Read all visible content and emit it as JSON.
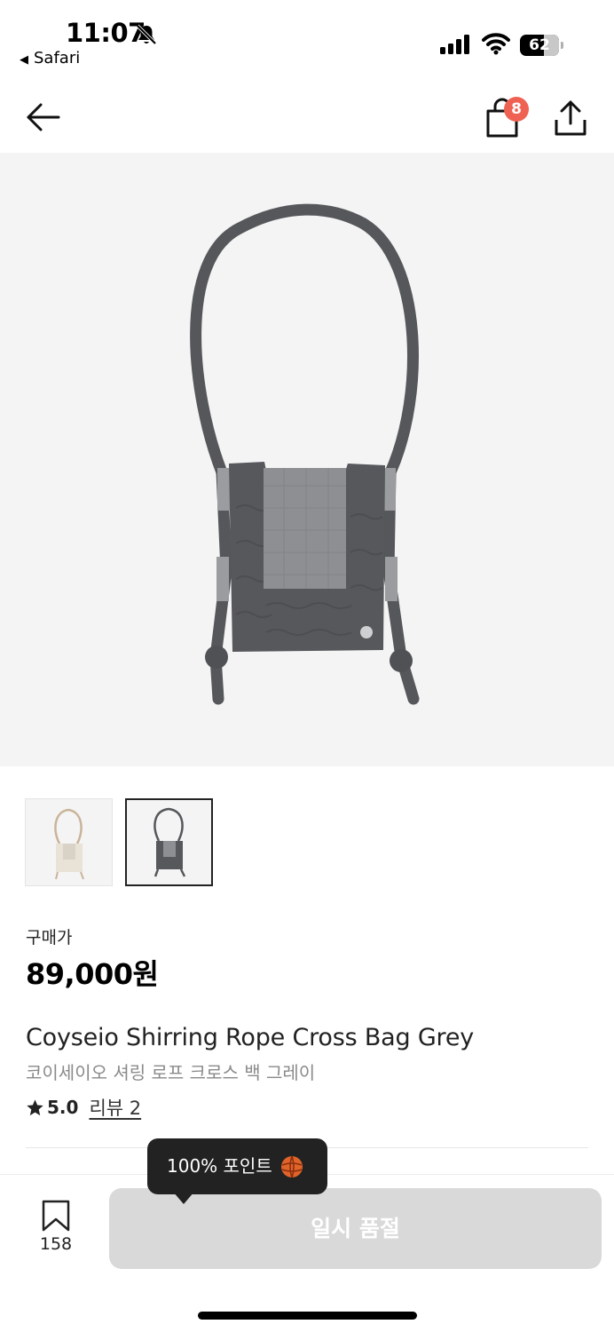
{
  "status_bar": {
    "time": "11:07",
    "back_app": "Safari",
    "battery_percent": "62",
    "battery_level": 0.62,
    "icons": [
      "bell-slash-icon",
      "signal-icon",
      "wifi-icon",
      "battery-icon"
    ]
  },
  "nav": {
    "icons": [
      "arrow-left-icon",
      "shopping-bag-icon",
      "share-icon"
    ],
    "cart_count": "8"
  },
  "product": {
    "price_label": "구매가",
    "price": "89,000원",
    "name_en": "Coyseio Shirring Rope Cross Bag Grey",
    "name_ko": "코이세이오 셔링 로프 크로스 백 그레이",
    "rating": "5.0",
    "review_label": "리뷰 2",
    "thumbnails": [
      {
        "variant": "ivory",
        "selected": false
      },
      {
        "variant": "grey",
        "selected": true
      }
    ]
  },
  "bottom": {
    "bookmark_count": "158",
    "button_label": "일시 품절",
    "tooltip": "100% 포인트",
    "tooltip_icon": "coin-ball-icon"
  },
  "colors": {
    "badge": "#ef6253",
    "button_disabled": "#d9d9d9",
    "tooltip_bg": "#222222",
    "hero_bg": "#f4f4f4"
  }
}
